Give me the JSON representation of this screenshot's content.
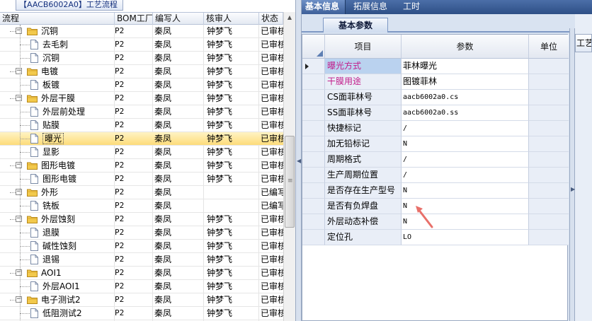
{
  "left": {
    "title": "【AACB6002A0】工艺流程",
    "columns": [
      "流程",
      "BOM工厂",
      "编写人",
      "核审人",
      "状态"
    ],
    "rows": [
      {
        "label": "沉铜",
        "type": "folder",
        "level": 1,
        "bom": "P2",
        "writer": "秦凤",
        "reviewer": "钟梦飞",
        "status": "已审核"
      },
      {
        "label": "去毛刺",
        "type": "file",
        "level": 2,
        "bom": "P2",
        "writer": "秦凤",
        "reviewer": "钟梦飞",
        "status": "已审核"
      },
      {
        "label": "沉铜",
        "type": "file",
        "level": 2,
        "bom": "P2",
        "writer": "秦凤",
        "reviewer": "钟梦飞",
        "status": "已审核"
      },
      {
        "label": "电镀",
        "type": "folder",
        "level": 1,
        "bom": "P2",
        "writer": "秦凤",
        "reviewer": "钟梦飞",
        "status": "已审核"
      },
      {
        "label": "板镀",
        "type": "file",
        "level": 2,
        "bom": "P2",
        "writer": "秦凤",
        "reviewer": "钟梦飞",
        "status": "已审核"
      },
      {
        "label": "外层干膜",
        "type": "folder",
        "level": 1,
        "bom": "P2",
        "writer": "秦凤",
        "reviewer": "钟梦飞",
        "status": "已审核"
      },
      {
        "label": "外层前处理",
        "type": "file",
        "level": 2,
        "bom": "P2",
        "writer": "秦凤",
        "reviewer": "钟梦飞",
        "status": "已审核"
      },
      {
        "label": "贴膜",
        "type": "file",
        "level": 2,
        "bom": "P2",
        "writer": "秦凤",
        "reviewer": "钟梦飞",
        "status": "已审核"
      },
      {
        "label": "曝光",
        "type": "file",
        "level": 2,
        "bom": "P2",
        "writer": "秦凤",
        "reviewer": "钟梦飞",
        "status": "已审核",
        "selected": true
      },
      {
        "label": "显影",
        "type": "file",
        "level": 2,
        "bom": "P2",
        "writer": "秦凤",
        "reviewer": "钟梦飞",
        "status": "已审核"
      },
      {
        "label": "图形电镀",
        "type": "folder",
        "level": 1,
        "bom": "P2",
        "writer": "秦凤",
        "reviewer": "钟梦飞",
        "status": "已审核"
      },
      {
        "label": "图形电镀",
        "type": "file",
        "level": 2,
        "bom": "P2",
        "writer": "秦凤",
        "reviewer": "钟梦飞",
        "status": "已审核"
      },
      {
        "label": "外形",
        "type": "folder",
        "level": 1,
        "bom": "P2",
        "writer": "秦凤",
        "reviewer": "",
        "status": "已编写"
      },
      {
        "label": "铣板",
        "type": "file",
        "level": 2,
        "bom": "P2",
        "writer": "秦凤",
        "reviewer": "",
        "status": "已编写"
      },
      {
        "label": "外层蚀刻",
        "type": "folder",
        "level": 1,
        "bom": "P2",
        "writer": "秦凤",
        "reviewer": "钟梦飞",
        "status": "已审核"
      },
      {
        "label": "退膜",
        "type": "file",
        "level": 2,
        "bom": "P2",
        "writer": "秦凤",
        "reviewer": "钟梦飞",
        "status": "已审核"
      },
      {
        "label": "碱性蚀刻",
        "type": "file",
        "level": 2,
        "bom": "P2",
        "writer": "秦凤",
        "reviewer": "钟梦飞",
        "status": "已审核"
      },
      {
        "label": "退锡",
        "type": "file",
        "level": 2,
        "bom": "P2",
        "writer": "秦凤",
        "reviewer": "钟梦飞",
        "status": "已审核"
      },
      {
        "label": "AOI1",
        "type": "folder",
        "level": 1,
        "bom": "P2",
        "writer": "秦凤",
        "reviewer": "钟梦飞",
        "status": "已审核"
      },
      {
        "label": "外层AOI1",
        "type": "file",
        "level": 2,
        "bom": "P2",
        "writer": "秦凤",
        "reviewer": "钟梦飞",
        "status": "已审核"
      },
      {
        "label": "电子测试2",
        "type": "folder",
        "level": 1,
        "bom": "P2",
        "writer": "秦凤",
        "reviewer": "钟梦飞",
        "status": "已审核"
      },
      {
        "label": "低阻测试2",
        "type": "file",
        "level": 2,
        "bom": "P2",
        "writer": "秦凤",
        "reviewer": "钟梦飞",
        "status": "已审核"
      }
    ]
  },
  "right": {
    "tabs": [
      "基本信息",
      "拓展信息",
      "工时"
    ],
    "subtab": "基本参数",
    "side_tab": "工艺",
    "columns": [
      "项目",
      "参数",
      "单位"
    ],
    "params": [
      {
        "name": "曝光方式",
        "value": "菲林曝光",
        "mono": false,
        "pink": true,
        "selected": true
      },
      {
        "name": "干膜用途",
        "value": "图镀菲林",
        "mono": false,
        "pink": true
      },
      {
        "name": "CS面菲林号",
        "value": "aacb6002a0.cs",
        "mono": true
      },
      {
        "name": "SS面菲林号",
        "value": "aacb6002a0.ss",
        "mono": true
      },
      {
        "name": "快捷标记",
        "value": "/",
        "mono": true
      },
      {
        "name": "加无铅标记",
        "value": "N",
        "mono": true
      },
      {
        "name": "周期格式",
        "value": "/",
        "mono": true
      },
      {
        "name": "生产周期位置",
        "value": "/",
        "mono": true
      },
      {
        "name": "是否存在生产型号",
        "value": "N",
        "mono": true
      },
      {
        "name": "是否有负焊盘",
        "value": "N",
        "mono": true
      },
      {
        "name": "外层动态补偿",
        "value": "N",
        "mono": true
      },
      {
        "name": "定位孔",
        "value": "LO",
        "mono": true
      }
    ]
  },
  "colors": {
    "accent": "#2e4f86",
    "selected_row": "#fddc7a",
    "pink_label": "#c21d8b",
    "arrow": "#e8706a"
  }
}
